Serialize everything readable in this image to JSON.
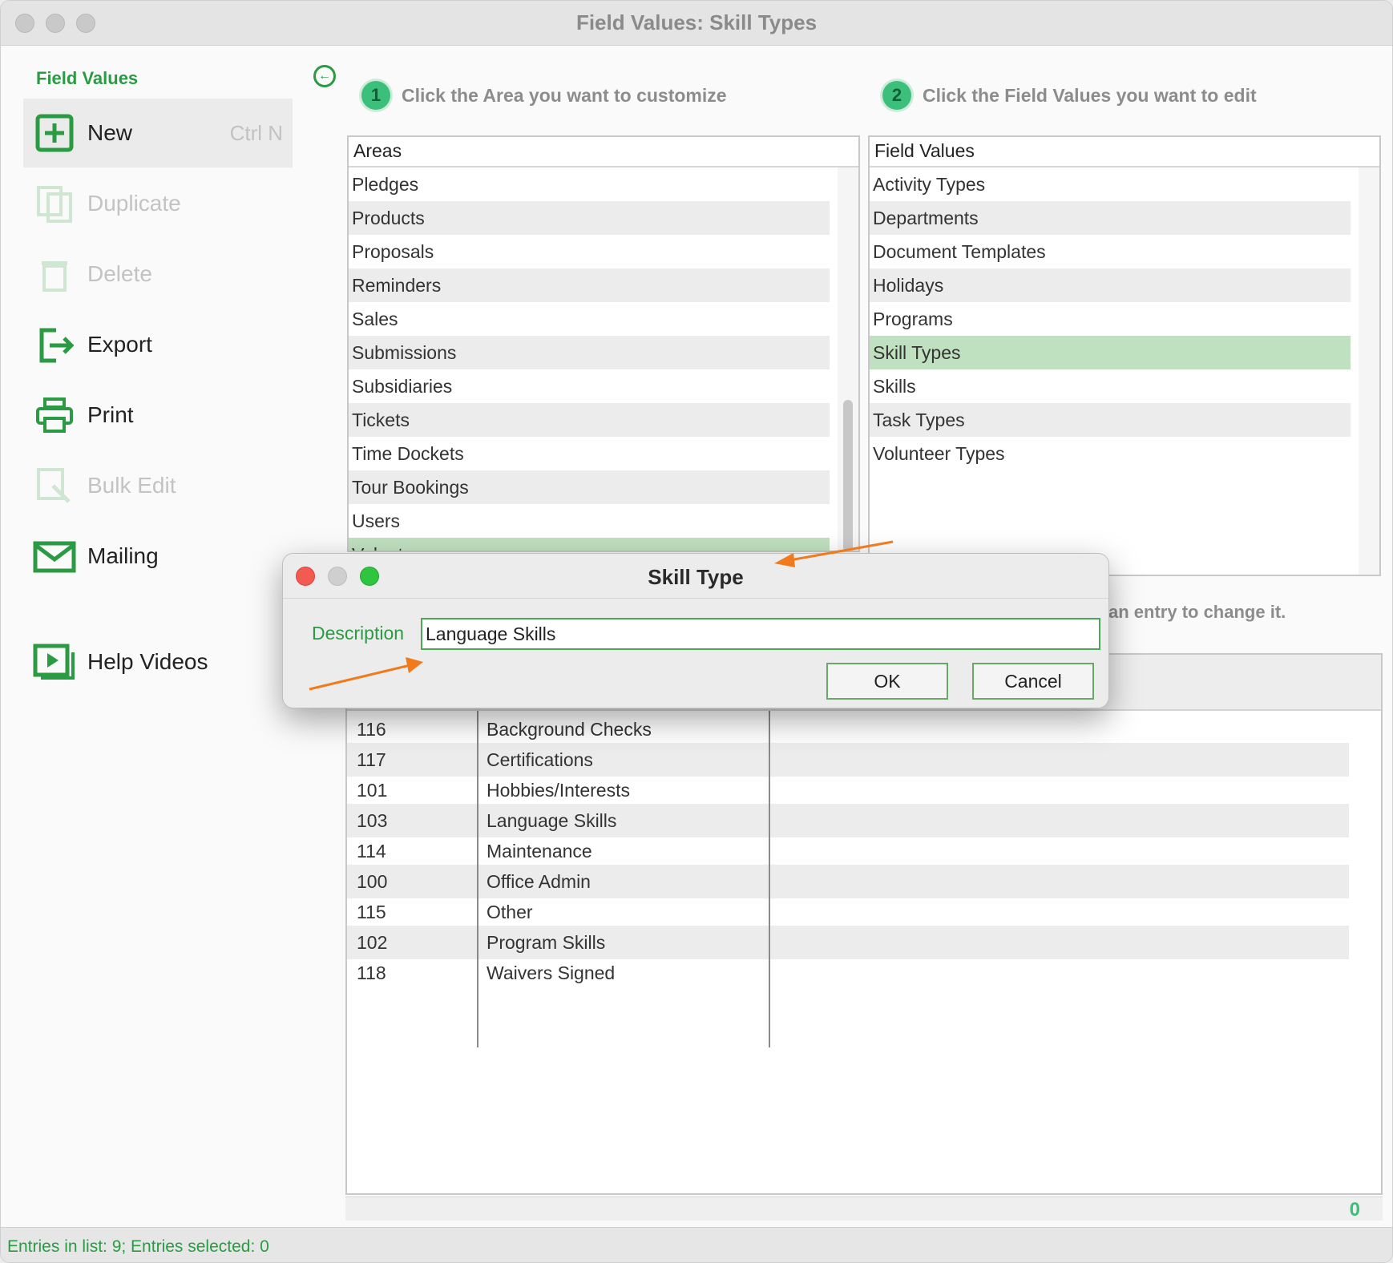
{
  "window": {
    "title": "Field Values: Skill Types"
  },
  "sidebar": {
    "title": "Field Values",
    "items": [
      {
        "label": "New",
        "shortcut": "Ctrl N",
        "icon": "plus-square-icon"
      },
      {
        "label": "Duplicate",
        "icon": "duplicate-icon"
      },
      {
        "label": "Delete",
        "icon": "trash-icon"
      },
      {
        "label": "Export",
        "icon": "export-icon"
      },
      {
        "label": "Print",
        "icon": "printer-icon"
      },
      {
        "label": "Bulk Edit",
        "icon": "bulk-edit-icon"
      },
      {
        "label": "Mailing",
        "icon": "envelope-icon"
      },
      {
        "label": "Help Videos",
        "icon": "video-icon"
      }
    ]
  },
  "steps": {
    "step1": {
      "num": "1",
      "text": "Click the Area you want to customize"
    },
    "step2": {
      "num": "2",
      "text": "Click the Field Values you want to edit"
    },
    "step3_partial": "an entry to change it."
  },
  "areas": {
    "header": "Areas",
    "items": [
      "Pledges",
      "Products",
      "Proposals",
      "Reminders",
      "Sales",
      "Submissions",
      "Subsidiaries",
      "Tickets",
      "Time Dockets",
      "Tour Bookings",
      "Users",
      "Volunteers"
    ],
    "selected": "Volunteers"
  },
  "field_values": {
    "header": "Field Values",
    "items": [
      "Activity Types",
      "Departments",
      "Document Templates",
      "Holidays",
      "Programs",
      "Skill Types",
      "Skills",
      "Task Types",
      "Volunteer Types"
    ],
    "selected": "Skill Types"
  },
  "entries": [
    {
      "id": "116",
      "name": "Background Checks"
    },
    {
      "id": "117",
      "name": "Certifications"
    },
    {
      "id": "101",
      "name": "Hobbies/Interests"
    },
    {
      "id": "103",
      "name": "Language Skills"
    },
    {
      "id": "114",
      "name": "Maintenance"
    },
    {
      "id": "100",
      "name": "Office Admin"
    },
    {
      "id": "115",
      "name": "Other"
    },
    {
      "id": "102",
      "name": "Program Skills"
    },
    {
      "id": "118",
      "name": "Waivers Signed"
    }
  ],
  "count_badge": "0",
  "status": "Entries in list: 9; Entries selected: 0",
  "dialog": {
    "title": "Skill Type",
    "label": "Description",
    "value": "Language Skills",
    "ok": "OK",
    "cancel": "Cancel"
  },
  "colors": {
    "accent": "#2a9b43",
    "selection": "#bfe1bf",
    "annotation_arrow": "#f07a1c"
  }
}
